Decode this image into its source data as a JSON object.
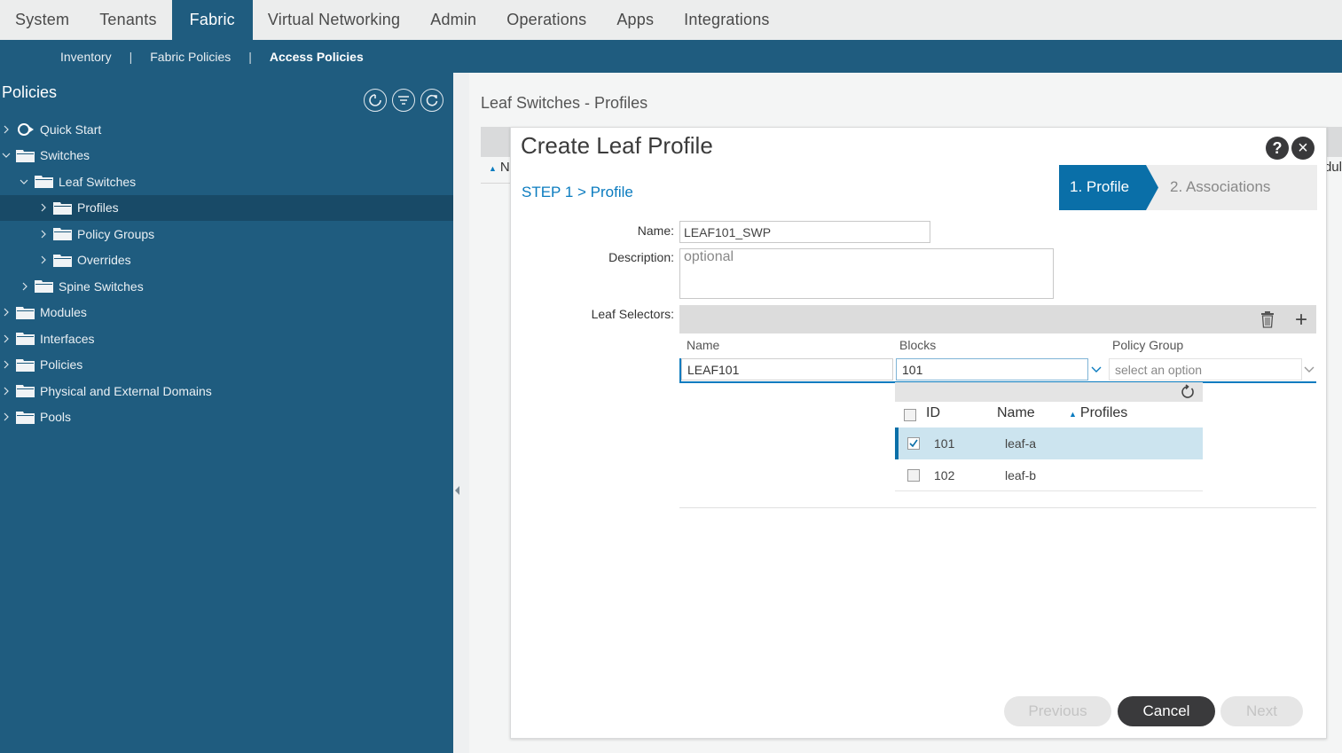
{
  "top_nav": {
    "tabs": [
      "System",
      "Tenants",
      "Fabric",
      "Virtual Networking",
      "Admin",
      "Operations",
      "Apps",
      "Integrations"
    ],
    "active": "Fabric"
  },
  "sub_nav": {
    "items": [
      "Inventory",
      "Fabric Policies",
      "Access Policies"
    ],
    "separator": "|",
    "active": "Access Policies"
  },
  "sidebar": {
    "title": "Policies",
    "tree": [
      {
        "label": "Quick Start",
        "icon": "quick-start-icon"
      },
      {
        "label": "Switches",
        "icon": "folder-icon",
        "expanded": true
      },
      {
        "label": "Leaf Switches",
        "icon": "folder-icon",
        "expanded": true
      },
      {
        "label": "Profiles",
        "icon": "folder-icon",
        "selected": true
      },
      {
        "label": "Policy Groups",
        "icon": "folder-icon"
      },
      {
        "label": "Overrides",
        "icon": "folder-icon"
      },
      {
        "label": "Spine Switches",
        "icon": "folder-icon"
      },
      {
        "label": "Modules",
        "icon": "folder-icon"
      },
      {
        "label": "Interfaces",
        "icon": "folder-icon"
      },
      {
        "label": "Policies",
        "icon": "folder-icon"
      },
      {
        "label": "Physical and External Domains",
        "icon": "folder-icon"
      },
      {
        "label": "Pools",
        "icon": "folder-icon"
      }
    ]
  },
  "content": {
    "title": "Leaf Switches - Profiles",
    "col_fragment_left": "N",
    "col_fragment_right": "dul"
  },
  "modal": {
    "title": "Create Leaf Profile",
    "help": "?",
    "close": "×",
    "step_text": "STEP 1 > Profile",
    "wizard": {
      "step1": "1. Profile",
      "step2": "2. Associations"
    },
    "fields": {
      "name_label": "Name:",
      "name_value": "LEAF101_SWP",
      "description_label": "Description:",
      "description_placeholder": "optional",
      "leaf_selectors_label": "Leaf Selectors:"
    },
    "selector_table": {
      "columns": [
        "Name",
        "Blocks",
        "Policy Group"
      ],
      "row": {
        "name": "LEAF101",
        "blocks": "101",
        "policy_group_placeholder": "select an option"
      }
    },
    "blocks_dropdown": {
      "columns": [
        "ID",
        "Name",
        "Profiles"
      ],
      "rows": [
        {
          "id": "101",
          "name": "leaf-a",
          "checked": true
        },
        {
          "id": "102",
          "name": "leaf-b",
          "checked": false
        }
      ]
    },
    "buttons": {
      "previous": "Previous",
      "cancel": "Cancel",
      "next": "Next"
    }
  }
}
